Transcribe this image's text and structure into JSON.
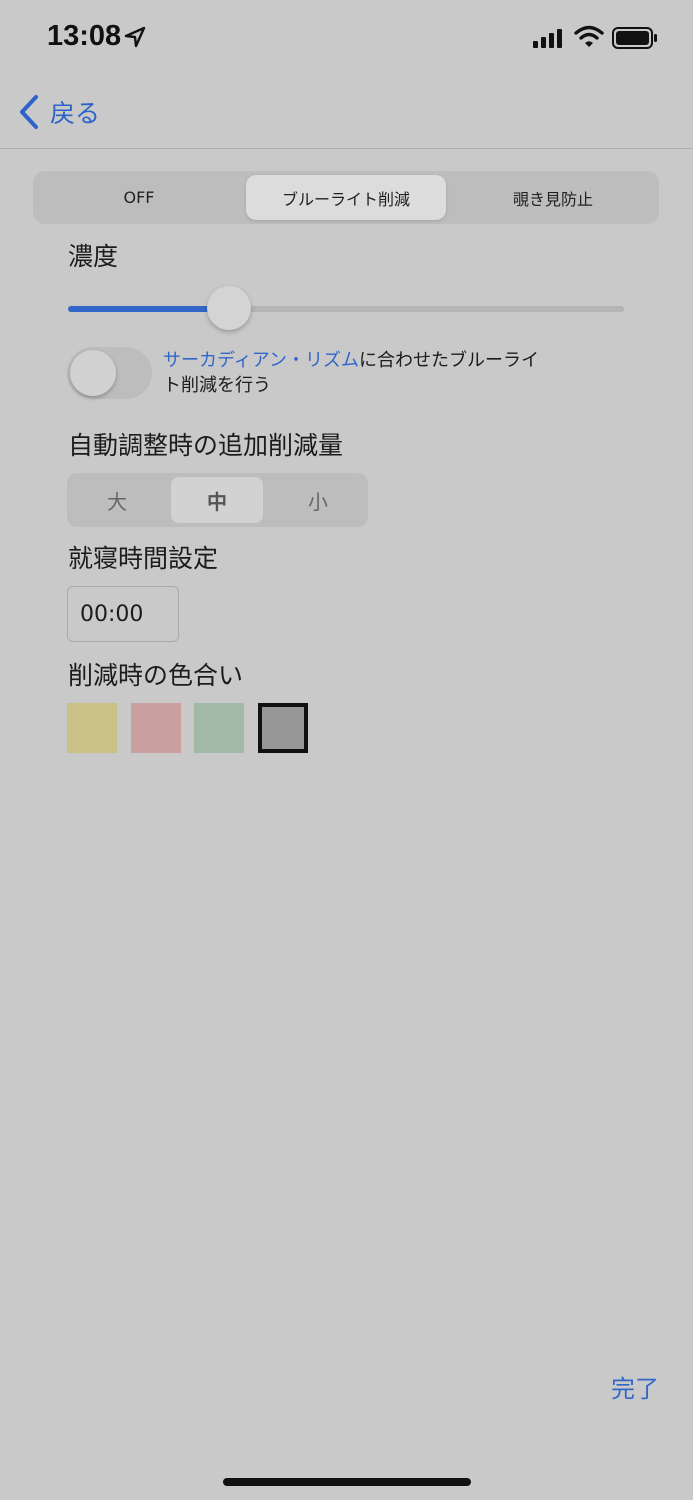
{
  "status_bar": {
    "time": "13:08"
  },
  "nav": {
    "back_label": "戻る"
  },
  "mode_tabs": [
    {
      "label": "OFF",
      "selected": false
    },
    {
      "label": "ブルーライト削減",
      "selected": true
    },
    {
      "label": "覗き見防止",
      "selected": false
    }
  ],
  "intensity": {
    "title": "濃度",
    "value_fraction": 0.29
  },
  "circadian": {
    "enabled": false,
    "link_text": "サーカディアン・リズム",
    "text_line1": "に合わせたブルーライ",
    "text_line2": "ト削減を行う"
  },
  "auto_adjust": {
    "title": "自動調整時の追加削減量",
    "options": [
      {
        "label": "大",
        "selected": false
      },
      {
        "label": "中",
        "selected": true
      },
      {
        "label": "小",
        "selected": false
      }
    ]
  },
  "bedtime": {
    "title": "就寝時間設定",
    "value": "00:00"
  },
  "tint": {
    "title": "削減時の色合い",
    "swatches": [
      {
        "name": "yellow",
        "color": "#c9c185",
        "selected": false
      },
      {
        "name": "pink",
        "color": "#c99f9f",
        "selected": false
      },
      {
        "name": "green",
        "color": "#a3b9a8",
        "selected": false
      },
      {
        "name": "gray",
        "color": "#979797",
        "selected": true
      }
    ]
  },
  "done_label": "完了",
  "colors": {
    "accent": "#3267c9",
    "background": "#c9c9c9"
  }
}
